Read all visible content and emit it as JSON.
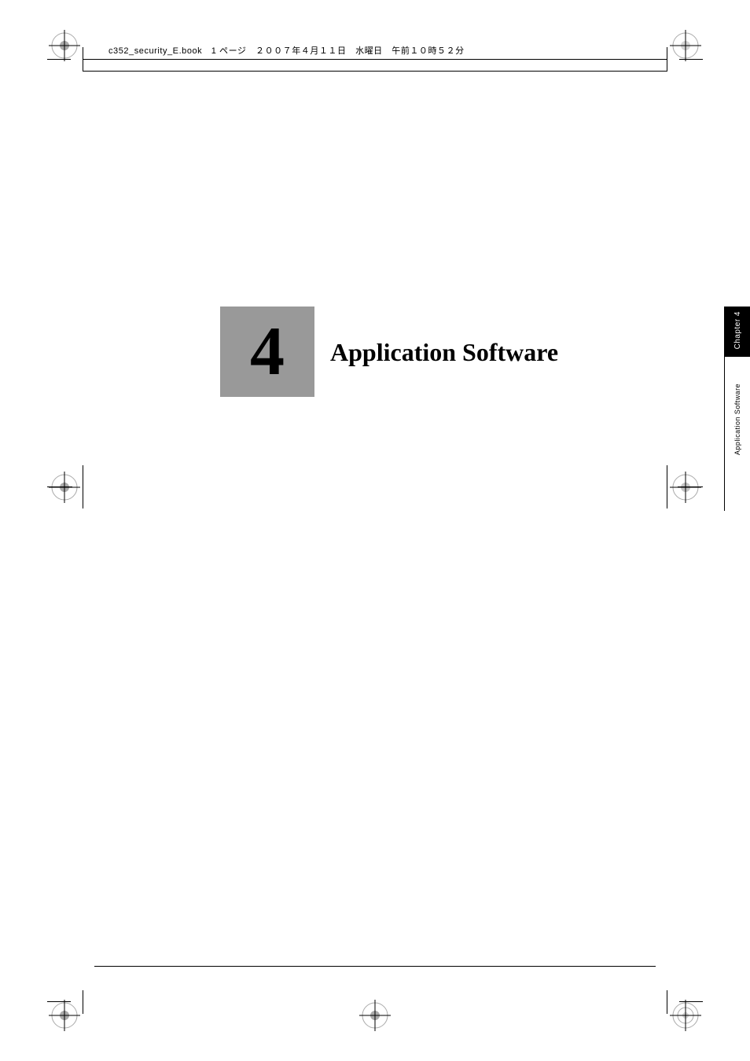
{
  "header": {
    "metadata": "c352_security_E.book　1 ページ　２００７年４月１１日　水曜日　午前１０時５２分"
  },
  "chapter": {
    "number": "4",
    "title": "Application Software",
    "sidebar_chapter_label": "Chapter 4",
    "sidebar_app_label": "Application Software"
  },
  "colors": {
    "chapter_block_bg": "#999999",
    "sidebar_tab_bg": "#000000",
    "text_white": "#ffffff",
    "text_black": "#000000"
  }
}
